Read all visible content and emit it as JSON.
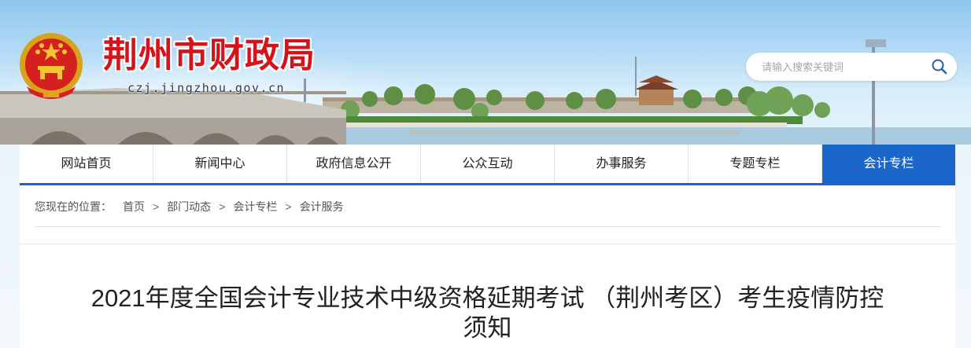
{
  "header": {
    "site_title": "荆州市财政局",
    "site_domain": "czj.jingzhou.gov.cn",
    "emblem_icon": "national-emblem-icon",
    "search": {
      "placeholder": "请输入搜索关键词",
      "value": "",
      "button_icon": "search-icon"
    }
  },
  "nav": {
    "items": [
      {
        "label": "网站首页",
        "active": false
      },
      {
        "label": "新闻中心",
        "active": false
      },
      {
        "label": "政府信息公开",
        "active": false
      },
      {
        "label": "公众互动",
        "active": false
      },
      {
        "label": "办事服务",
        "active": false
      },
      {
        "label": "专题专栏",
        "active": false
      },
      {
        "label": "会计专栏",
        "active": true
      }
    ]
  },
  "breadcrumb": {
    "lead": "您现在的位置：",
    "separator": ">",
    "items": [
      "首页",
      "部门动态",
      "会计专栏",
      "会计服务"
    ]
  },
  "article": {
    "title_line1": "2021年度全国会计专业技术中级资格延期考试 （荆州考区）考生疫情防控",
    "title_line2": "须知"
  },
  "colors": {
    "title_red": "#d4141b",
    "nav_active": "#1b66c9",
    "banner_sky": "#8ec7ef"
  }
}
